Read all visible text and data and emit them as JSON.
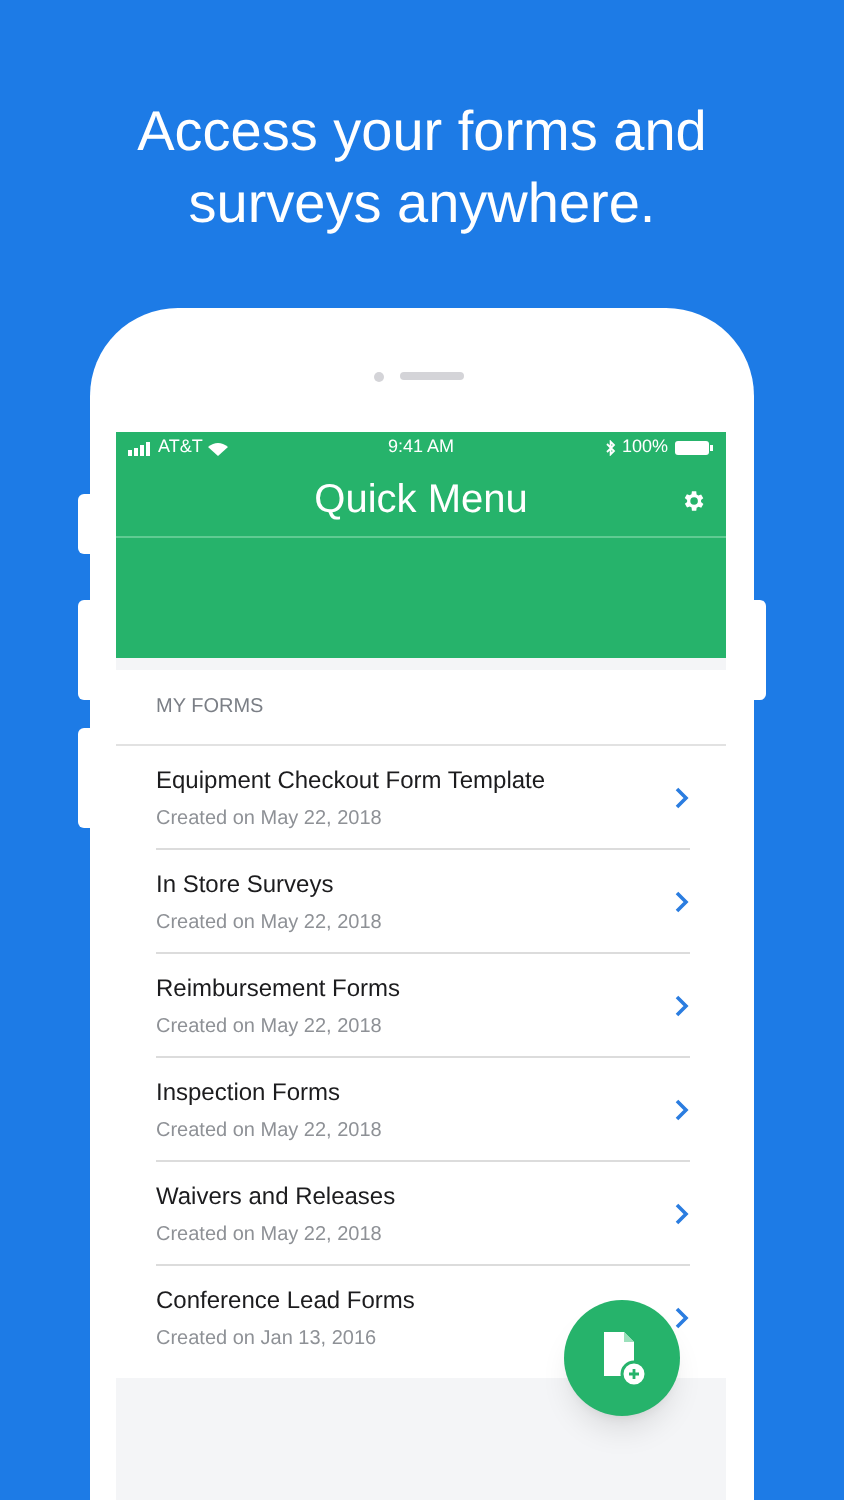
{
  "headline": "Access your forms and surveys anywhere.",
  "status_bar": {
    "carrier": "AT&T",
    "time": "9:41 AM",
    "battery": "100%"
  },
  "header": {
    "title": "Quick Menu"
  },
  "section_label": "MY FORMS",
  "forms": [
    {
      "title": "Equipment Checkout Form Template",
      "subtitle": "Created on May 22, 2018"
    },
    {
      "title": "In Store Surveys",
      "subtitle": "Created on May 22, 2018"
    },
    {
      "title": "Reimbursement Forms",
      "subtitle": "Created on May 22, 2018"
    },
    {
      "title": "Inspection Forms",
      "subtitle": "Created on May 22, 2018"
    },
    {
      "title": "Waivers and Releases",
      "subtitle": "Created on May 22, 2018"
    },
    {
      "title": "Conference Lead Forms",
      "subtitle": "Created on Jan 13, 2016"
    }
  ]
}
